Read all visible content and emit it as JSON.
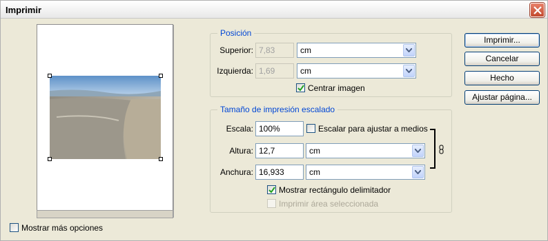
{
  "window": {
    "title": "Imprimir"
  },
  "position": {
    "legend": "Posición",
    "top_label": "Superior:",
    "top_value": "7,83",
    "top_unit": "cm",
    "left_label": "Izquierda:",
    "left_value": "1,69",
    "left_unit": "cm",
    "center_label": "Centrar imagen",
    "center_checked": true
  },
  "scale": {
    "legend": "Tamaño de impresión escalado",
    "scale_label": "Escala:",
    "scale_value": "100%",
    "fit_label": "Escalar para ajustar a medios",
    "fit_checked": false,
    "height_label": "Altura:",
    "height_value": "12,7",
    "height_unit": "cm",
    "width_label": "Anchura:",
    "width_value": "16,933",
    "width_unit": "cm",
    "bbox_label": "Mostrar rectángulo delimitador",
    "bbox_checked": true,
    "selection_label": "Imprimir área seleccionada",
    "selection_checked": false
  },
  "buttons": {
    "print": "Imprimir...",
    "cancel": "Cancelar",
    "done": "Hecho",
    "page_setup": "Ajustar página..."
  },
  "more_options": {
    "label": "Mostrar más opciones",
    "checked": false
  }
}
